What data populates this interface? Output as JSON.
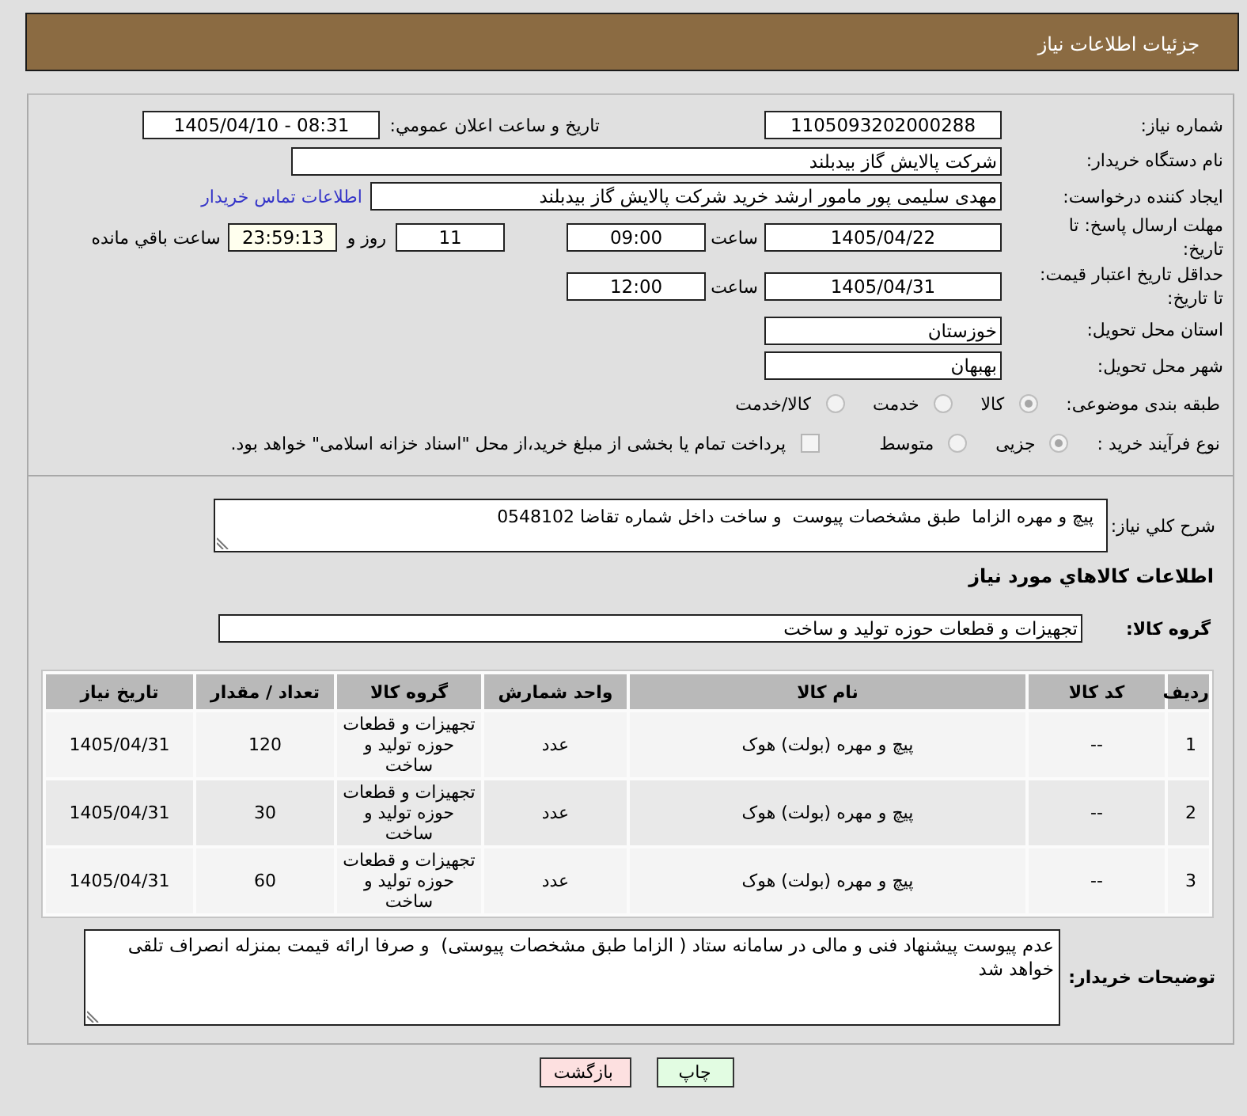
{
  "header": {
    "title": "جزئیات اطلاعات نیاز"
  },
  "need_number": {
    "label": "شماره نیاز:",
    "value": "1105093202000288"
  },
  "announce_date": {
    "label": "تاريخ و ساعت اعلان عمومي:",
    "value": "1405/04/10 - 08:31"
  },
  "buyer_org": {
    "label": "نام دستگاه خریدار:",
    "value": "شرکت پالایش گاز بیدبلند"
  },
  "requester": {
    "label": "ایجاد کننده درخواست:",
    "value": "مهدی سلیمی پور مامور ارشد خرید شرکت پالایش گاز بیدبلند",
    "contact_link": "اطلاعات تماس خریدار"
  },
  "response_deadline": {
    "label": "مهلت ارسال پاسخ: تا تاریخ:",
    "date": "1405/04/22",
    "time_label": "ساعت",
    "time": "09:00",
    "days": "11",
    "days_label": "روز و",
    "remaining": "23:59:13",
    "remaining_label": "ساعت باقي مانده"
  },
  "price_validity": {
    "label": "حداقل تاریخ اعتبار قیمت: تا تاریخ:",
    "date": "1405/04/31",
    "time_label": "ساعت",
    "time": "12:00"
  },
  "province": {
    "label": "استان محل تحویل:",
    "value": "خوزستان"
  },
  "city": {
    "label": "شهر محل تحویل:",
    "value": "بهبهان"
  },
  "category": {
    "label": "طبقه بندی موضوعی:",
    "options": [
      {
        "label": "کالا",
        "selected": true
      },
      {
        "label": "خدمت",
        "selected": false
      },
      {
        "label": "کالا/خدمت",
        "selected": false
      }
    ]
  },
  "purchase_process": {
    "label": "نوع فرآیند خرید :",
    "options": [
      {
        "label": "جزیی",
        "selected": true
      },
      {
        "label": "متوسط",
        "selected": false
      }
    ],
    "treasury_payment": {
      "label": "پرداخت تمام یا بخشی از مبلغ خرید،از محل \"اسناد خزانه اسلامی\" خواهد بود.",
      "checked": false
    }
  },
  "summary": {
    "label": "شرح کلي نياز:",
    "value": "پیچ و مهره الزاما  طبق مشخصات پیوست  و ساخت داخل شماره تقاضا 0548102"
  },
  "goods_section": {
    "title": "اطلاعات کالاهاي مورد نياز"
  },
  "goods_group": {
    "label": "گروه کالا:",
    "value": "تجهیزات و قطعات حوزه تولید و ساخت"
  },
  "table": {
    "columns": [
      "ردیف",
      "کد کالا",
      "نام کالا",
      "واحد شمارش",
      "گروه کالا",
      "تعداد / مقدار",
      "تاریخ نیاز"
    ],
    "rows": [
      [
        "1",
        "--",
        "پیچ و مهره (بولت) هوک",
        "عدد",
        "تجهیزات و قطعات حوزه تولید و ساخت",
        "120",
        "1405/04/31"
      ],
      [
        "2",
        "--",
        "پیچ و مهره (بولت) هوک",
        "عدد",
        "تجهیزات و قطعات حوزه تولید و ساخت",
        "30",
        "1405/04/31"
      ],
      [
        "3",
        "--",
        "پیچ و مهره (بولت) هوک",
        "عدد",
        "تجهیزات و قطعات حوزه تولید و ساخت",
        "60",
        "1405/04/31"
      ]
    ]
  },
  "buyer_notes": {
    "label": "توضیحات خریدار:",
    "value": "عدم پیوست پیشنهاد فنی و مالی در سامانه ستاد ( الزاما طبق مشخصات پیوستی)  و صرفا ارائه قیمت بمنزله انصراف تلقی خواهد شد"
  },
  "buttons": [
    {
      "label": "چاپ",
      "kind": "print"
    },
    {
      "label": "بازگشت",
      "kind": "back"
    }
  ]
}
